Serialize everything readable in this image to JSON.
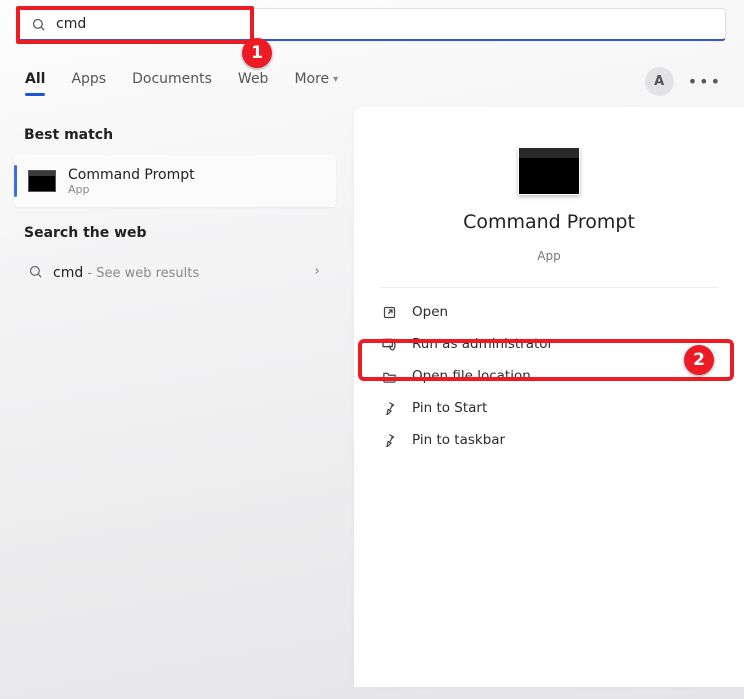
{
  "search": {
    "value": "cmd"
  },
  "tabs": {
    "all": "All",
    "apps": "Apps",
    "documents": "Documents",
    "web": "Web",
    "more": "More"
  },
  "avatar_initial": "A",
  "sections": {
    "best_match": "Best match",
    "search_web": "Search the web"
  },
  "best_match": {
    "title": "Command Prompt",
    "subtitle": "App"
  },
  "web_result": {
    "keyword": "cmd",
    "hint": " - See web results"
  },
  "details": {
    "title": "Command Prompt",
    "kind": "App"
  },
  "actions": {
    "open": "Open",
    "run_as_admin": "Run as administrator",
    "open_location": "Open file location",
    "pin_start": "Pin to Start",
    "pin_taskbar": "Pin to taskbar"
  },
  "callouts": {
    "one": "1",
    "two": "2"
  }
}
